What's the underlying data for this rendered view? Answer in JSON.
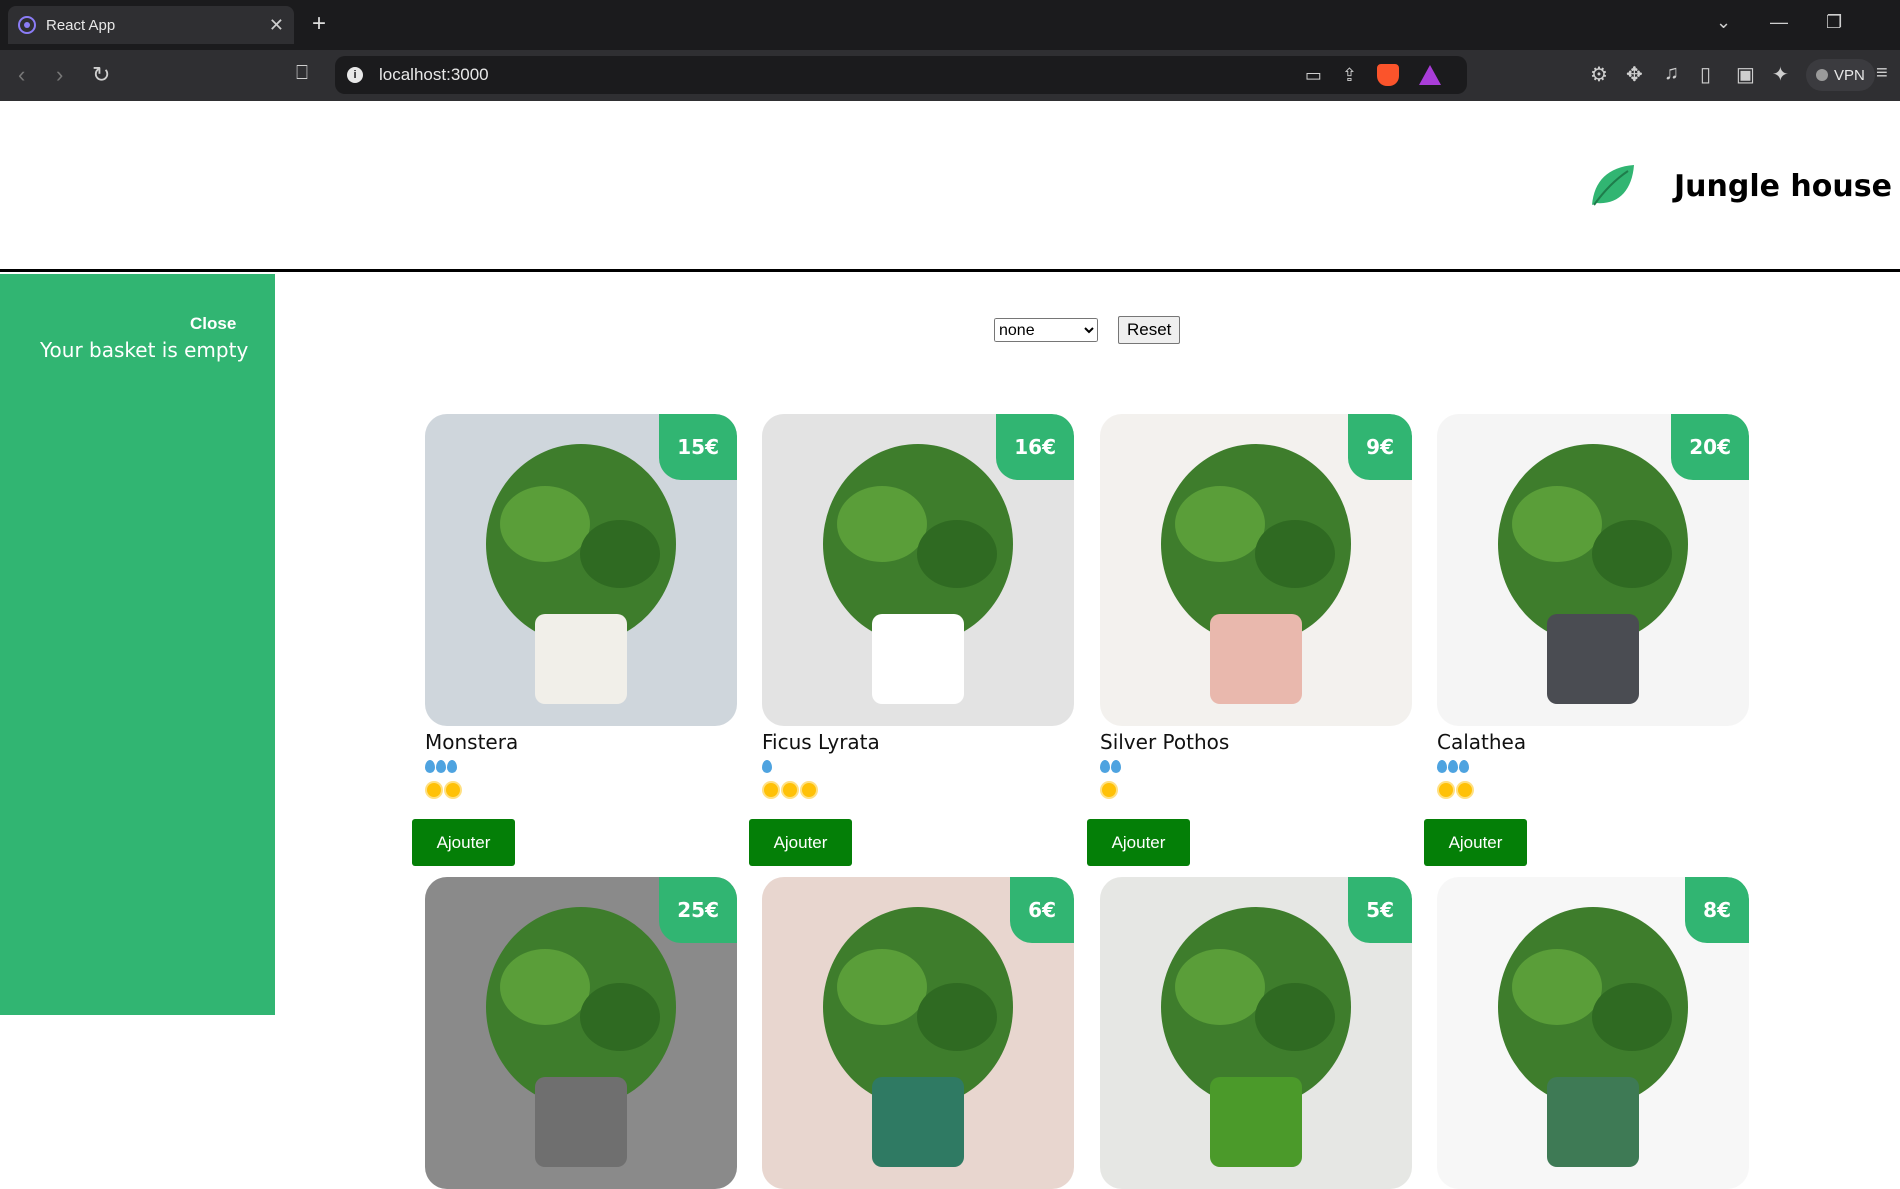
{
  "browser": {
    "tab_title": "React App",
    "url": "localhost:3000",
    "vpn_label": "VPN"
  },
  "header": {
    "title": "Jungle house"
  },
  "cart": {
    "close_label": "Close",
    "empty_message": "Your basket is empty"
  },
  "filters": {
    "selected_category": "none",
    "reset_label": "Reset"
  },
  "plants": [
    {
      "name": "Monstera",
      "price": "15€",
      "water": 3,
      "light": 2,
      "button": "Ajouter",
      "bg": "#cfd6dc",
      "pot": "#f1efe9"
    },
    {
      "name": "Ficus Lyrata",
      "price": "16€",
      "water": 1,
      "light": 3,
      "button": "Ajouter",
      "bg": "#e3e3e3",
      "pot": "#ffffff"
    },
    {
      "name": "Silver Pothos",
      "price": "9€",
      "water": 2,
      "light": 1,
      "button": "Ajouter",
      "bg": "#f3f1ee",
      "pot": "#e9b8ad"
    },
    {
      "name": "Calathea",
      "price": "20€",
      "water": 3,
      "light": 2,
      "button": "Ajouter",
      "bg": "#f5f5f5",
      "pot": "#4a4c52"
    },
    {
      "name": "",
      "price": "25€",
      "bg": "#8a8a8a",
      "pot": "#6f6f6f"
    },
    {
      "name": "",
      "price": "6€",
      "bg": "#e8d6cf",
      "pot": "#2f7a63"
    },
    {
      "name": "",
      "price": "5€",
      "bg": "#e6e7e4",
      "pot": "#4b9a2a"
    },
    {
      "name": "",
      "price": "8€",
      "bg": "#f7f7f7",
      "pot": "#3e7a55"
    }
  ],
  "colors": {
    "accent": "#31b572",
    "button": "#047f07"
  }
}
